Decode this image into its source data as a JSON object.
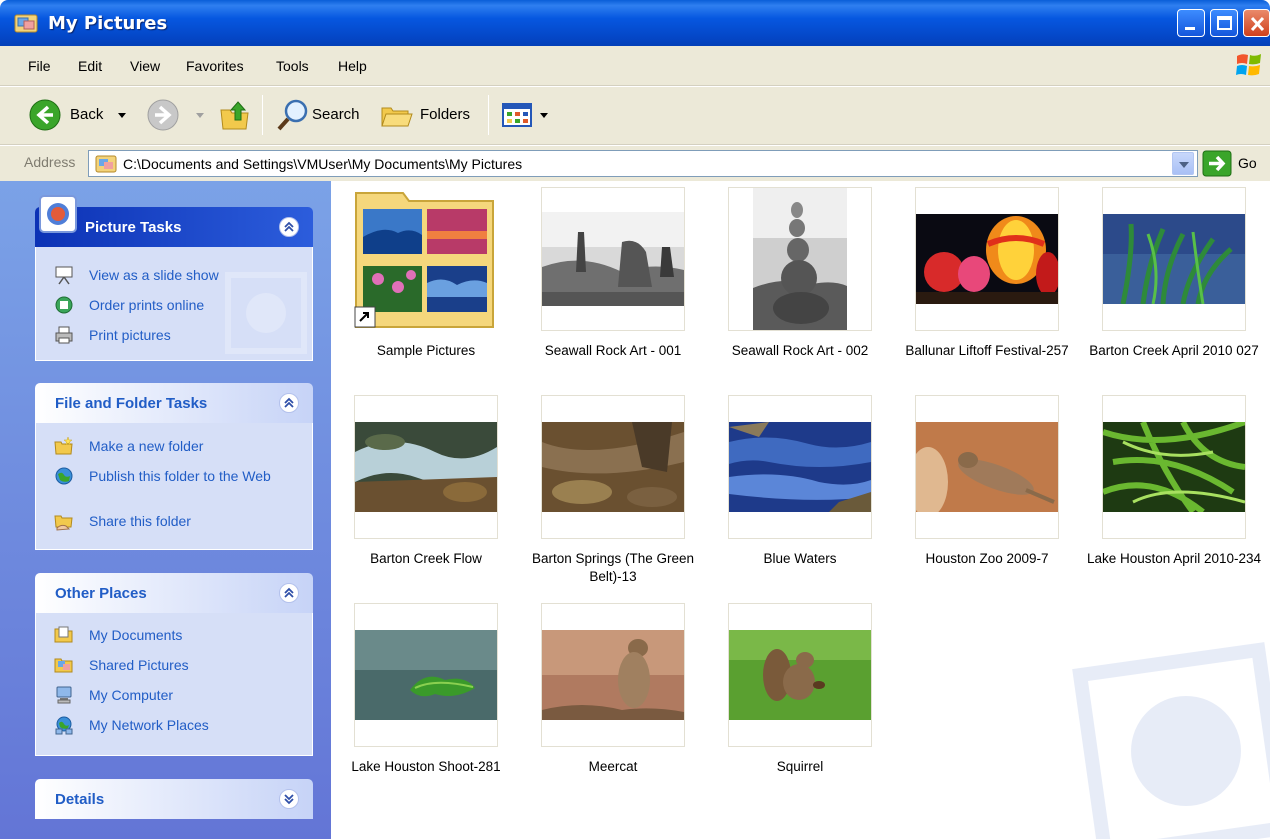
{
  "window": {
    "title": "My Pictures",
    "controls": [
      "minimize",
      "maximize",
      "close"
    ]
  },
  "menu": [
    "File",
    "Edit",
    "View",
    "Favorites",
    "Tools",
    "Help"
  ],
  "toolbar": {
    "back_label": "Back",
    "search_label": "Search",
    "folders_label": "Folders"
  },
  "address": {
    "label": "Address",
    "path": "C:\\Documents and Settings\\VMUser\\My Documents\\My Pictures",
    "go_label": "Go"
  },
  "sidebar": {
    "picture_tasks": {
      "title": "Picture Tasks",
      "items": [
        {
          "label": "View as a slide show",
          "icon": "slideshow-icon"
        },
        {
          "label": "Order prints online",
          "icon": "order-prints-icon"
        },
        {
          "label": "Print pictures",
          "icon": "printer-icon"
        }
      ]
    },
    "file_tasks": {
      "title": "File and Folder Tasks",
      "items": [
        {
          "label": "Make a new folder",
          "icon": "new-folder-icon"
        },
        {
          "label": "Publish this folder to the Web",
          "icon": "publish-web-icon"
        },
        {
          "label": "Share this folder",
          "icon": "share-folder-icon"
        }
      ]
    },
    "other_places": {
      "title": "Other Places",
      "items": [
        {
          "label": "My Documents",
          "icon": "my-documents-icon"
        },
        {
          "label": "Shared Pictures",
          "icon": "shared-pictures-icon"
        },
        {
          "label": "My Computer",
          "icon": "my-computer-icon"
        },
        {
          "label": "My Network Places",
          "icon": "network-places-icon"
        }
      ]
    },
    "details": {
      "title": "Details"
    }
  },
  "files": [
    {
      "name": "Sample Pictures",
      "type": "folder-shortcut"
    },
    {
      "name": "Seawall Rock Art - 001",
      "type": "image"
    },
    {
      "name": "Seawall Rock Art - 002",
      "type": "image"
    },
    {
      "name": "Ballunar Liftoff Festival-257",
      "type": "image"
    },
    {
      "name": "Barton Creek April 2010 027",
      "type": "image"
    },
    {
      "name": "Barton Creek Flow",
      "type": "image"
    },
    {
      "name": "Barton Springs (The Green Belt)-13",
      "type": "image"
    },
    {
      "name": "Blue Waters",
      "type": "image"
    },
    {
      "name": "Houston Zoo 2009-7",
      "type": "image"
    },
    {
      "name": "Lake Houston April 2010-234",
      "type": "image"
    },
    {
      "name": "Lake Houston Shoot-281",
      "type": "image"
    },
    {
      "name": "Meercat",
      "type": "image"
    },
    {
      "name": "Squirrel",
      "type": "image"
    }
  ],
  "colors": {
    "titlebar": "#0657e0",
    "sidebar": "#6f8ddd",
    "task_link": "#215dc6",
    "chrome": "#ece9d8"
  }
}
